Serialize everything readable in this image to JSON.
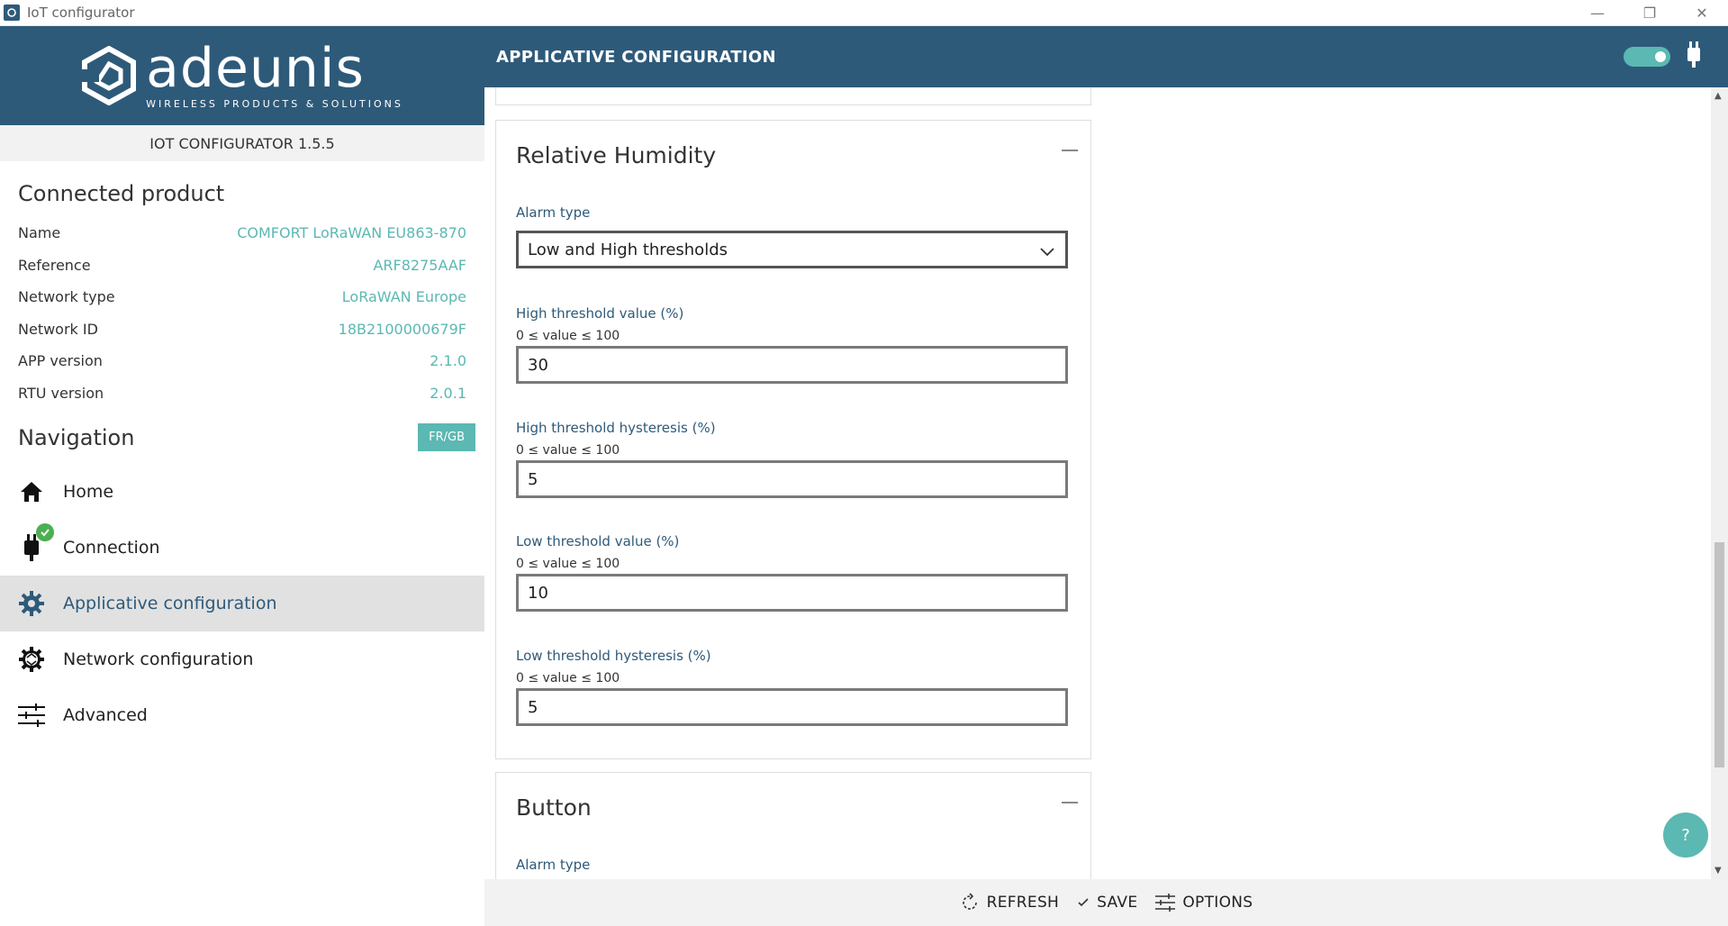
{
  "window": {
    "title": "IoT configurator",
    "minimize_glyph": "—",
    "restore_glyph": "❐",
    "close_glyph": "✕"
  },
  "brand": {
    "wordmark": "adeunis",
    "tagline": "WIRELESS PRODUCTS & SOLUTIONS"
  },
  "sidebar": {
    "version": "IOT CONFIGURATOR 1.5.5",
    "connected_title": "Connected product",
    "product": [
      {
        "key": "Name",
        "value": "COMFORT LoRaWAN EU863-870"
      },
      {
        "key": "Reference",
        "value": "ARF8275AAF"
      },
      {
        "key": "Network type",
        "value": "LoRaWAN Europe"
      },
      {
        "key": "Network ID",
        "value": "18B2100000679F"
      },
      {
        "key": "APP version",
        "value": "2.1.0"
      },
      {
        "key": "RTU version",
        "value": "2.0.1"
      }
    ],
    "nav_title": "Navigation",
    "lang_button": "FR/GB",
    "nav": [
      {
        "label": "Home",
        "icon": "home-icon"
      },
      {
        "label": "Connection",
        "icon": "plug-icon"
      },
      {
        "label": "Applicative configuration",
        "icon": "gear-icon",
        "active": true
      },
      {
        "label": "Network configuration",
        "icon": "network-gear-icon"
      },
      {
        "label": "Advanced",
        "icon": "sliders-icon"
      }
    ]
  },
  "header": {
    "title": "APPLICATIVE CONFIGURATION"
  },
  "rh_card": {
    "title": "Relative Humidity",
    "alarm_label": "Alarm type",
    "alarm_value": "Low and High thresholds",
    "fields": [
      {
        "label": "High threshold value (%)",
        "hint": "0 ≤ value ≤ 100",
        "value": "30"
      },
      {
        "label": "High threshold hysteresis (%)",
        "hint": "0 ≤ value ≤ 100",
        "value": "5"
      },
      {
        "label": "Low threshold value (%)",
        "hint": "0 ≤ value ≤ 100",
        "value": "10"
      },
      {
        "label": "Low threshold hysteresis (%)",
        "hint": "0 ≤ value ≤ 100",
        "value": "5"
      }
    ]
  },
  "button_card": {
    "title": "Button",
    "alarm_label": "Alarm type"
  },
  "help": {
    "label": "?"
  },
  "bottombar": {
    "refresh": "REFRESH",
    "save": "SAVE",
    "options": "OPTIONS"
  },
  "colors": {
    "primary": "#2e5a7a",
    "accent": "#5cb8b2",
    "active_bg": "#e1e1e1"
  }
}
